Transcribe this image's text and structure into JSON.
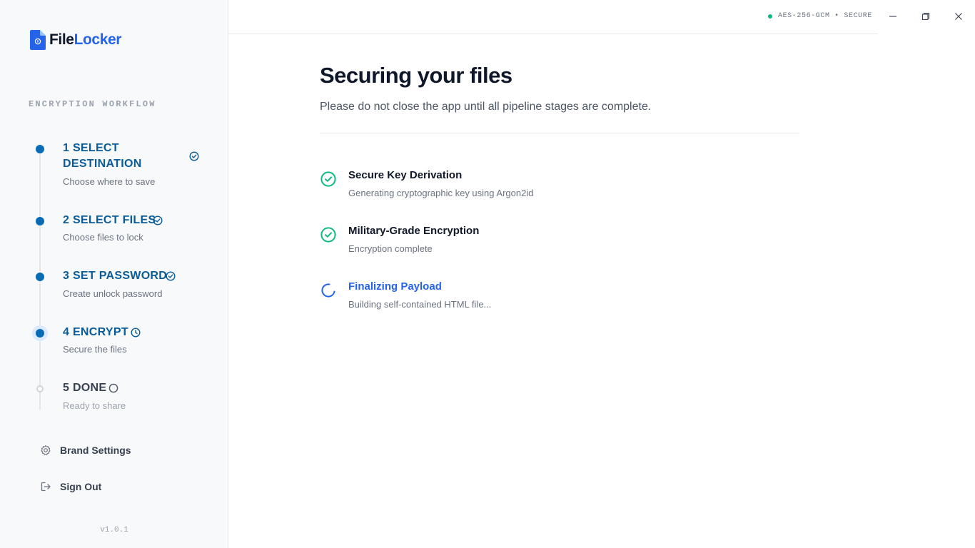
{
  "app": {
    "logo_part1": "File",
    "logo_part2": "Locker",
    "brand_color": "#2563eb"
  },
  "sidebar": {
    "workflow_title": "ENCRYPTION WORKFLOW",
    "steps": [
      {
        "title_line1": "1 SELECT",
        "title_line2": "DESTINATION",
        "subtitle": "Choose where to save",
        "state": "complete",
        "icon": "check-circle-icon"
      },
      {
        "title": "2 SELECT FILES",
        "subtitle": "Choose files to lock",
        "state": "complete",
        "icon": "check-circle-icon"
      },
      {
        "title": "3 SET PASSWORD",
        "subtitle": "Create unlock password",
        "state": "complete",
        "icon": "check-circle-icon"
      },
      {
        "title": "4 ENCRYPT",
        "subtitle": "Secure the files",
        "state": "active",
        "icon": "clock-icon"
      },
      {
        "title": "5 DONE",
        "subtitle": "Ready to share",
        "state": "pending",
        "icon": "empty-circle-icon"
      }
    ],
    "links": [
      {
        "label": "Brand Settings",
        "icon": "gear-icon"
      },
      {
        "label": "Sign Out",
        "icon": "sign-out-icon"
      }
    ],
    "version": "v1.0.1"
  },
  "topbar": {
    "status_text": "AES-256-GCM • SECURE",
    "status_color": "#10b981"
  },
  "main": {
    "title": "Securing your files",
    "subtitle": "Please do not close the app until all pipeline stages are complete.",
    "stages": [
      {
        "title": "Secure Key Derivation",
        "subtitle": "Generating cryptographic key using Argon2id",
        "state": "complete",
        "icon": "check-circle-icon"
      },
      {
        "title": "Military-Grade Encryption",
        "subtitle": "Encryption complete",
        "state": "complete",
        "icon": "check-circle-icon"
      },
      {
        "title": "Finalizing Payload",
        "subtitle": "Building self-contained HTML file...",
        "state": "in-progress",
        "icon": "spinner-icon"
      }
    ]
  }
}
